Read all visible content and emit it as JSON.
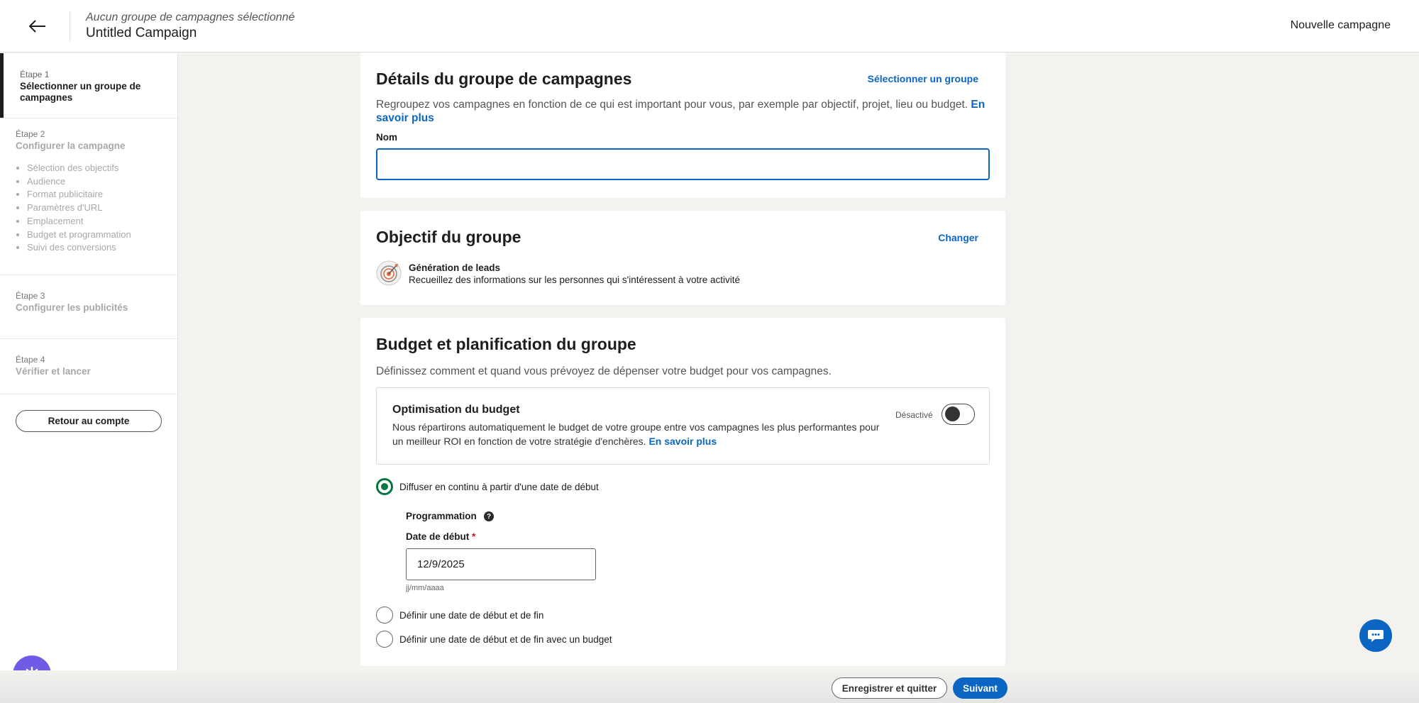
{
  "header": {
    "subtitle": "Aucun groupe de campagnes sélectionné",
    "title": "Untitled Campaign",
    "right_label": "Nouvelle campagne"
  },
  "sidebar": {
    "steps": [
      {
        "num": "Étape 1",
        "title": "Sélectionner un groupe de campagnes"
      },
      {
        "num": "Étape 2",
        "title": "Configurer la campagne",
        "items": [
          "Sélection des objectifs",
          "Audience",
          "Format publicitaire",
          "Paramètres d'URL",
          "Emplacement",
          "Budget et programmation",
          "Suivi des conversions"
        ]
      },
      {
        "num": "Étape 3",
        "title": "Configurer les publicités"
      },
      {
        "num": "Étape 4",
        "title": "Vérifier et lancer"
      }
    ],
    "back_label": "Retour au compte"
  },
  "details": {
    "heading": "Détails du groupe de campagnes",
    "select_link": "Sélectionner un groupe",
    "description": "Regroupez vos campagnes en fonction de ce qui est important pour vous, par exemple par objectif, projet, lieu ou budget.",
    "learn_more": "En savoir plus",
    "name_label": "Nom",
    "name_value": ""
  },
  "objective": {
    "heading": "Objectif du groupe",
    "change_link": "Changer",
    "title": "Génération de leads",
    "description": "Recueillez des informations sur les personnes qui s'intéressent à votre activité"
  },
  "budget": {
    "heading": "Budget et planification du groupe",
    "description": "Définissez comment et quand vous prévoyez de dépenser votre budget pour vos campagnes.",
    "optimization": {
      "title": "Optimisation du budget",
      "description": "Nous répartirons automatiquement le budget de votre groupe entre vos campagnes les plus performantes pour un meilleur ROI en fonction de votre stratégie d'enchères.",
      "learn_more": "En savoir plus",
      "state": "Désactivé"
    },
    "radio_options": [
      "Diffuser en continu à partir d'une date de début",
      "Définir une date de début et de fin",
      "Définir une date de début et de fin avec un budget"
    ],
    "selected_option": 0,
    "schedule_label": "Programmation",
    "start_date_label": "Date de début",
    "required_mark": "*",
    "start_date_value": "12/9/2025",
    "date_hint": "jj/mm/aaaa"
  },
  "footer": {
    "save_label": "Enregistrer et quitter",
    "next_label": "Suivant"
  },
  "colors": {
    "accent": "#0a66c2",
    "success": "#057642",
    "help_fab": "#6f5ce6"
  }
}
